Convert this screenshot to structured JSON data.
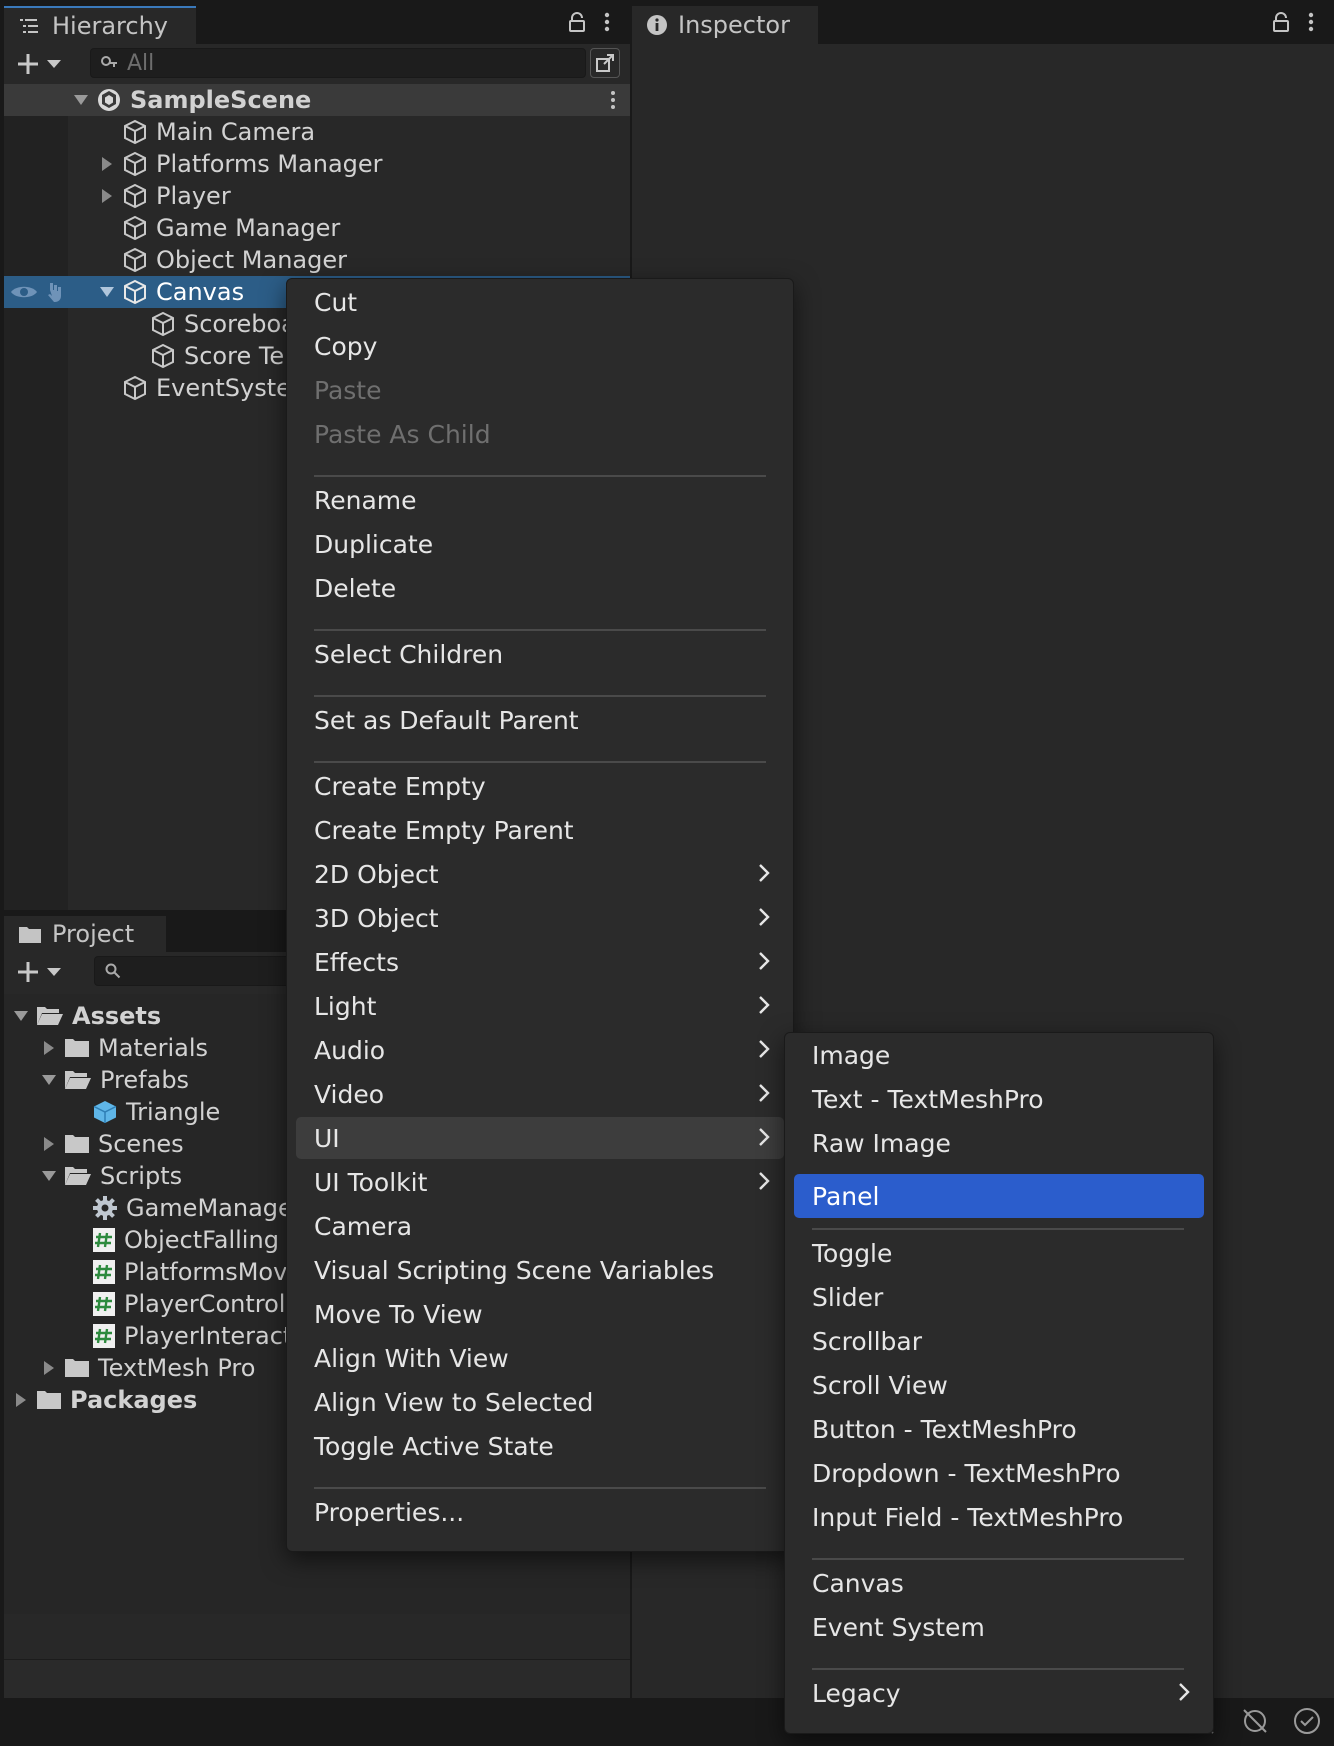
{
  "hierarchy": {
    "tab_label": "Hierarchy",
    "search_placeholder": "All",
    "scene": "SampleScene",
    "items": [
      {
        "label": "Main Camera"
      },
      {
        "label": "Platforms Manager"
      },
      {
        "label": "Player"
      },
      {
        "label": "Game Manager"
      },
      {
        "label": "Object Manager"
      },
      {
        "label": "Canvas"
      },
      {
        "label": "Scoreboa"
      },
      {
        "label": "Score Te"
      },
      {
        "label": "EventSyste"
      }
    ]
  },
  "inspector": {
    "tab_label": "Inspector"
  },
  "project": {
    "tab_label": "Project",
    "items": [
      {
        "label": "Assets"
      },
      {
        "label": "Materials"
      },
      {
        "label": "Prefabs"
      },
      {
        "label": "Triangle"
      },
      {
        "label": "Scenes"
      },
      {
        "label": "Scripts"
      },
      {
        "label": "GameManage"
      },
      {
        "label": "ObjectFalling"
      },
      {
        "label": "PlatformsMov"
      },
      {
        "label": "PlayerControll"
      },
      {
        "label": "PlayerInteract"
      },
      {
        "label": "TextMesh Pro"
      },
      {
        "label": "Packages"
      }
    ]
  },
  "context_menu": {
    "items": [
      {
        "label": "Cut"
      },
      {
        "label": "Copy"
      },
      {
        "label": "Paste",
        "disabled": true
      },
      {
        "label": "Paste As Child",
        "disabled": true
      },
      {
        "label": "Rename"
      },
      {
        "label": "Duplicate"
      },
      {
        "label": "Delete"
      },
      {
        "label": "Select Children"
      },
      {
        "label": "Set as Default Parent"
      },
      {
        "label": "Create Empty"
      },
      {
        "label": "Create Empty Parent"
      },
      {
        "label": "2D Object"
      },
      {
        "label": "3D Object"
      },
      {
        "label": "Effects"
      },
      {
        "label": "Light"
      },
      {
        "label": "Audio"
      },
      {
        "label": "Video"
      },
      {
        "label": "UI"
      },
      {
        "label": "UI Toolkit"
      },
      {
        "label": "Camera"
      },
      {
        "label": "Visual Scripting Scene Variables"
      },
      {
        "label": "Move To View"
      },
      {
        "label": "Align With View"
      },
      {
        "label": "Align View to Selected"
      },
      {
        "label": "Toggle Active State"
      },
      {
        "label": "Properties..."
      }
    ]
  },
  "ui_submenu": {
    "items": [
      {
        "label": "Image"
      },
      {
        "label": "Text - TextMeshPro"
      },
      {
        "label": "Raw Image"
      },
      {
        "label": "Panel"
      },
      {
        "label": "Toggle"
      },
      {
        "label": "Slider"
      },
      {
        "label": "Scrollbar"
      },
      {
        "label": "Scroll View"
      },
      {
        "label": "Button - TextMeshPro"
      },
      {
        "label": "Dropdown - TextMeshPro"
      },
      {
        "label": "Input Field - TextMeshPro"
      },
      {
        "label": "Canvas"
      },
      {
        "label": "Event System"
      },
      {
        "label": "Legacy"
      }
    ]
  },
  "colors": {
    "selection": "#2b5dcc",
    "hierarchy_selected_row": "#2c5d87",
    "panel_bg": "#282828",
    "menu_bg": "#2b2b2b"
  }
}
